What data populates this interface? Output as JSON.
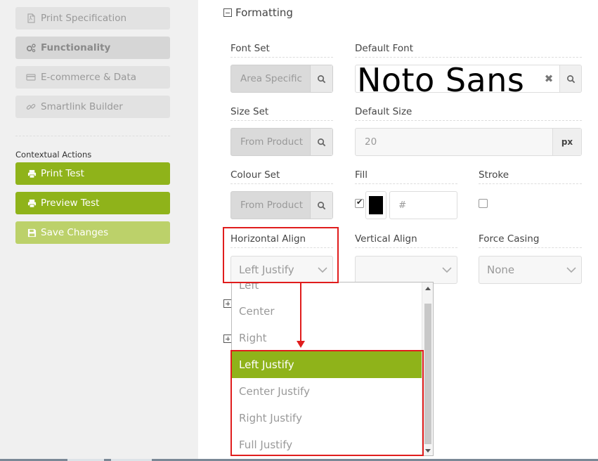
{
  "sidebar": {
    "nav": [
      {
        "label": "Print Specification",
        "icon": "pdf-file-icon"
      },
      {
        "label": "Functionality",
        "icon": "cogs-icon",
        "active": true
      },
      {
        "label": "E-commerce & Data",
        "icon": "credit-card-icon"
      },
      {
        "label": "Smartlink Builder",
        "icon": "link-icon"
      }
    ],
    "contextual_title": "Contextual Actions",
    "actions": [
      {
        "label": "Print Test",
        "icon": "printer-icon"
      },
      {
        "label": "Preview Test",
        "icon": "printer-icon"
      },
      {
        "label": "Save Changes",
        "icon": "floppy-disk-icon",
        "disabled": true
      }
    ]
  },
  "formatting": {
    "title": "Formatting",
    "font_set": {
      "label": "Font Set",
      "value": "Area Specific"
    },
    "default_font": {
      "label": "Default Font",
      "value": "Noto Sans"
    },
    "size_set": {
      "label": "Size Set",
      "value": "From Product"
    },
    "default_size": {
      "label": "Default Size",
      "value": "20",
      "unit": "px"
    },
    "colour_set": {
      "label": "Colour Set",
      "value": "From Product"
    },
    "fill": {
      "label": "Fill",
      "checked": true,
      "swatch": "#000000",
      "hex_placeholder": "#"
    },
    "stroke": {
      "label": "Stroke",
      "checked": false
    },
    "horizontal_align": {
      "label": "Horizontal Align",
      "value": "Left Justify",
      "options": [
        "Left",
        "Center",
        "Right",
        "Left Justify",
        "Center Justify",
        "Right Justify",
        "Full Justify"
      ]
    },
    "vertical_align": {
      "label": "Vertical Align",
      "value": ""
    },
    "force_casing": {
      "label": "Force Casing",
      "value": "None"
    }
  },
  "colors": {
    "accent": "#8fb31a",
    "annotation": "#e01d1d"
  }
}
